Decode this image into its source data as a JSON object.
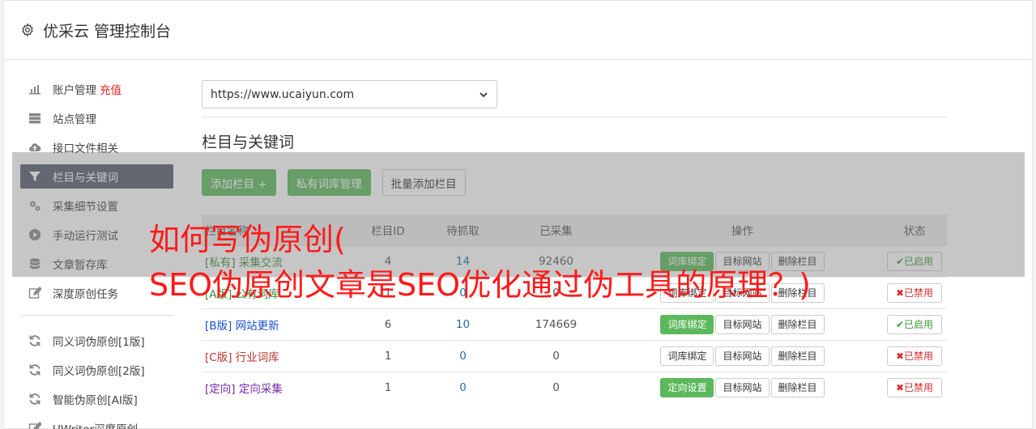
{
  "header": {
    "title": "优采云 管理控制台",
    "icon": "gear-icon"
  },
  "sidebar": {
    "items": [
      {
        "label": "账户管理",
        "accent": "充值",
        "icon": "bar-chart-icon"
      },
      {
        "label": "站点管理",
        "icon": "server-icon"
      },
      {
        "label": "接口文件相关",
        "icon": "cloud-upload-icon"
      },
      {
        "label": "栏目与关键词",
        "icon": "filter-icon",
        "active": true
      },
      {
        "label": "采集细节设置",
        "icon": "gears-icon"
      },
      {
        "label": "手动运行测试",
        "icon": "play-icon"
      },
      {
        "label": "文章暂存库",
        "icon": "database-icon"
      },
      {
        "label": "深度原创任务",
        "icon": "edit-icon"
      }
    ],
    "items2": [
      {
        "label": "同义词伪原创[1版]",
        "icon": "refresh-icon"
      },
      {
        "label": "同义词伪原创[2版]",
        "icon": "refresh-icon"
      },
      {
        "label": "智能伪原创[AI版]",
        "icon": "refresh-icon"
      },
      {
        "label": "UWriter深度原创",
        "icon": "edit-icon"
      }
    ]
  },
  "main": {
    "site_select": "https://www.ucaiyun.com",
    "section_title": "栏目与关键词",
    "buttons": {
      "add": "添加栏目 +",
      "private": "私有词库管理",
      "batch": "批量添加栏目"
    },
    "table": {
      "headers": [
        "栏目名称",
        "栏目ID",
        "待抓取",
        "已采集",
        "操作",
        "状态"
      ],
      "rows": [
        {
          "prefix": "[私有]",
          "name": "采集交流",
          "id": "4",
          "pending": "14",
          "collected": "92460",
          "op1": "词库绑定",
          "op2": "目标网站",
          "op3": "删除栏目",
          "status": "已启用",
          "color": "green",
          "op1_green": true,
          "on": true
        },
        {
          "prefix": "[A版]",
          "name": "公有词库",
          "id": "1",
          "pending": "0",
          "collected": "0",
          "op1": "词库绑定",
          "op2": "目标网站",
          "op3": "删除栏目",
          "status": "已禁用",
          "color": "green",
          "op1_green": false,
          "on": false
        },
        {
          "prefix": "[B版]",
          "name": "网站更新",
          "id": "6",
          "pending": "10",
          "collected": "174669",
          "op1": "词库绑定",
          "op2": "目标网站",
          "op3": "删除栏目",
          "status": "已启用",
          "color": "blue",
          "op1_green": true,
          "on": true
        },
        {
          "prefix": "[C版]",
          "name": "行业词库",
          "id": "1",
          "pending": "0",
          "collected": "0",
          "op1": "词库绑定",
          "op2": "目标网站",
          "op3": "删除栏目",
          "status": "已禁用",
          "color": "red",
          "op1_green": false,
          "on": false
        },
        {
          "prefix": "[定向]",
          "name": "定向采集",
          "id": "1",
          "pending": "0",
          "collected": "0",
          "op1": "定向设置",
          "op2": "目标网站",
          "op3": "删除栏目",
          "status": "已禁用",
          "color": "purple",
          "op1_green": true,
          "on": false
        }
      ]
    }
  },
  "overlay": {
    "line1": "如何写伪原创(",
    "line2": "SEO伪原创文章是SEO优化通过伪工具的原理？)"
  },
  "colors": {
    "accent_green": "#5cb85c",
    "sidebar_active": "#555d6b",
    "overlay_title": "#ff1a1a"
  }
}
